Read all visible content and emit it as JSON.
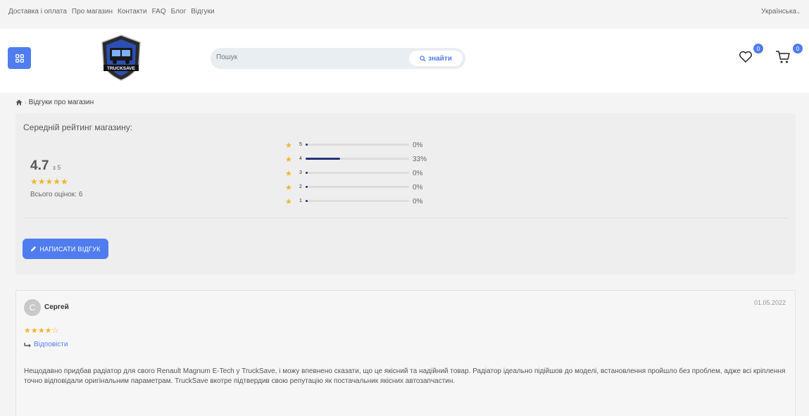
{
  "topbar": {
    "links": [
      "Доставка і оплата",
      "Про магазин",
      "Контакти",
      "FAQ",
      "Блог",
      "Відгуки"
    ],
    "language": "Українська"
  },
  "header": {
    "logo_text": "TRUCKSAVE",
    "search_placeholder": "Пошук",
    "search_button": "знайти",
    "wishlist_count": "0",
    "cart_count": "0"
  },
  "breadcrumb": {
    "current": "Відгуки про магазин"
  },
  "rating": {
    "title": "Середній рейтинг магазину:",
    "average": "4.7",
    "max_label": "з 5",
    "stars": "★★★★★",
    "total_label": "Всього оцінок: 6",
    "distribution": [
      {
        "stars": "5",
        "percent_label": "0%",
        "fraction": 0
      },
      {
        "stars": "4",
        "percent_label": "33%",
        "fraction": 0.33
      },
      {
        "stars": "3",
        "percent_label": "0%",
        "fraction": 0
      },
      {
        "stars": "2",
        "percent_label": "0%",
        "fraction": 0
      },
      {
        "stars": "1",
        "percent_label": "0%",
        "fraction": 0
      }
    ],
    "write_button": "НАПИСАТИ ВІДГУК"
  },
  "reviews": [
    {
      "avatar_letter": "С",
      "author": "Сергей",
      "date": "01.05.2022",
      "stars": "★★★★☆",
      "rating": 4,
      "reply_label": "Відповісти",
      "text": "Нещодавно придбав радіатор для свого Renault Magnum E-Tech у TruckSave, і можу впевнено сказати, що це якісний та надійний товар. Радіатор ідеально підійшов до моделі, встановлення пройшло без проблем, адже всі кріплення точно відповідали оригінальним параметрам. TruckSave вкотре підтвердив свою репутацію як постачальник якісних автозапчастин."
    }
  ],
  "colors": {
    "accent": "#4f7df0",
    "star": "#f0b62c",
    "bar_fill": "#24347a"
  }
}
